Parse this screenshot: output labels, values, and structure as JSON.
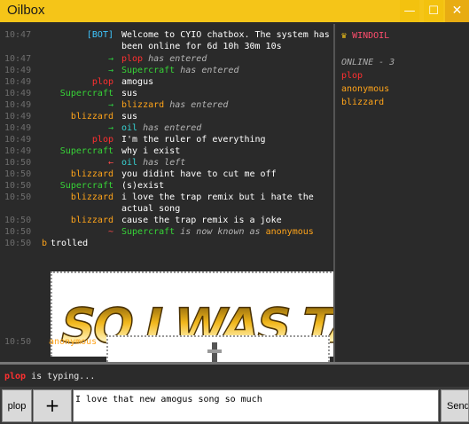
{
  "window": {
    "title": "Oilbox",
    "min_icon": "minimize-icon",
    "max_icon": "maximize-icon",
    "close_icon": "close-icon"
  },
  "chat": {
    "welcome": {
      "time": "10:47",
      "who": "[BOT]",
      "text": "Welcome to CYIO chatbox. The system has been online for 6d 10h 30m 10s"
    },
    "rows": [
      {
        "time": "10:47",
        "who": "→",
        "name": "plop",
        "text": "has entered"
      },
      {
        "time": "10:49",
        "who": "→",
        "name": "Supercraft",
        "text": "has entered"
      },
      {
        "time": "10:49",
        "who": "plop",
        "text": "amogus"
      },
      {
        "time": "10:49",
        "who": "Supercraft",
        "text": "sus"
      },
      {
        "time": "10:49",
        "who": "→",
        "name": "blizzard",
        "text": "has entered"
      },
      {
        "time": "10:49",
        "who": "blizzard",
        "text": "sus"
      },
      {
        "time": "10:49",
        "who": "→",
        "name": "oil",
        "text": "has entered"
      },
      {
        "time": "10:49",
        "who": "plop",
        "text": "I'm the ruler of everything"
      },
      {
        "time": "10:49",
        "who": "Supercraft",
        "text": "why i exist"
      },
      {
        "time": "10:50",
        "who": "←",
        "name": "oil",
        "text": "has left"
      },
      {
        "time": "10:50",
        "who": "blizzard",
        "text": "you didint have to cut me off"
      },
      {
        "time": "10:50",
        "who": "Supercraft",
        "text": "(s)exist"
      },
      {
        "time": "10:50",
        "who": "blizzard",
        "text": "i love the trap remix but i hate the actual song"
      },
      {
        "time": "10:50",
        "who": "blizzard",
        "text": "cause the trap remix is a joke"
      },
      {
        "time": "10:50",
        "who": "~",
        "name": "Supercraft",
        "text": "is now known as",
        "name2": "anonymous"
      },
      {
        "time": "10:50",
        "who": "b",
        "text": "trolled"
      },
      {
        "time": "10:50",
        "who": "anonymous",
        "text": ""
      }
    ],
    "image_text": "SO I WAS TALK"
  },
  "sidebar": {
    "room": "WINDOIL",
    "crown_icon": "crown-icon",
    "online_header": "ONLINE - 3",
    "users": [
      "plop",
      "anonymous",
      "blizzard"
    ]
  },
  "typing": {
    "user": "plop",
    "text": "is typing..."
  },
  "composer": {
    "user_button": "plop",
    "add_button": "+",
    "input_value": "I love that new amogus song so much",
    "send_button": "Send"
  },
  "colors": {
    "titlebar": "#f5c518",
    "bot": "#3ec6ff",
    "plop": "#ff3030",
    "supercraft": "#37d437",
    "blizzard": "#ffa41a",
    "oil": "#37d4d4"
  }
}
